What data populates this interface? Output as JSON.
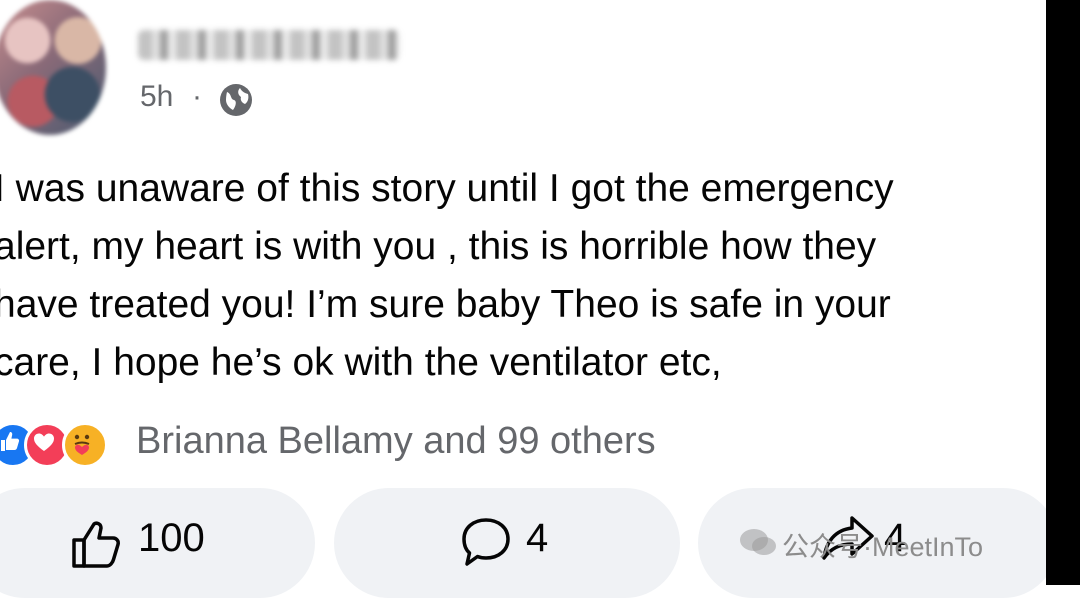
{
  "post": {
    "timestamp": "5h",
    "separator": "·",
    "privacy_icon": "globe-icon",
    "text": "I was unaware of this story until I got the emergency\nalert,  my heart is with you , this is horrible how they\nhave treated you! I’m sure baby Theo is safe in your\ncare, I hope he’s ok with the ventilator etc,"
  },
  "reactions": {
    "icons": [
      "like-icon",
      "love-icon",
      "care-icon"
    ],
    "summary": "Brianna Bellamy and 99 others"
  },
  "actions": {
    "like_count": "100",
    "comment_count": "4",
    "share_count": "4"
  },
  "watermark": {
    "text": "公众号·MeetInTo"
  },
  "colors": {
    "like_blue": "#1877f2",
    "love_red": "#f33e58",
    "care_yellow": "#f7b125",
    "secondary_text": "#65676b",
    "button_bg": "#f0f2f5"
  }
}
